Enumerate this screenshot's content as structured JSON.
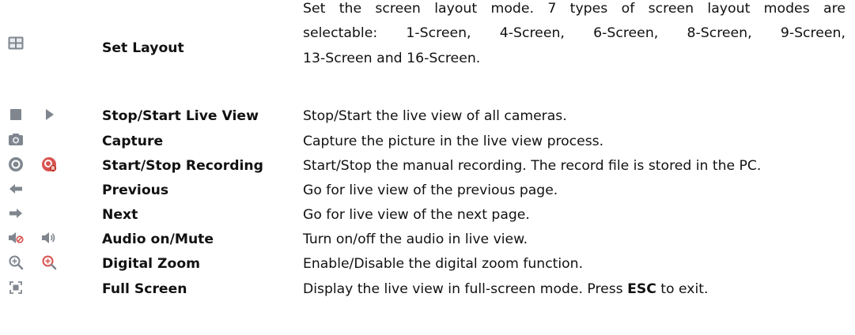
{
  "rows": [
    {
      "icons": [
        "layout-grid-icon"
      ],
      "name": "Set Layout",
      "desc_lines": [
        "Set the screen layout mode. 7 types of screen layout modes are",
        "selectable:  1-Screen,  4-Screen,  6-Screen,  8-Screen,  9-Screen,",
        "13-Screen and 16-Screen."
      ]
    },
    {
      "icons": [
        "stop-icon",
        "play-icon"
      ],
      "name": "Stop/Start Live View",
      "desc": "Stop/Start the live view of all cameras."
    },
    {
      "icons": [
        "camera-icon"
      ],
      "name": "Capture",
      "desc": "Capture the picture in the live view process."
    },
    {
      "icons": [
        "record-icon",
        "recording-active-icon"
      ],
      "name": "Start/Stop Recording",
      "desc": "Start/Stop the manual recording. The record file is stored in the PC."
    },
    {
      "icons": [
        "arrow-left-icon"
      ],
      "name": "Previous",
      "desc": "Go for live view of the previous page."
    },
    {
      "icons": [
        "arrow-right-icon"
      ],
      "name": "Next",
      "desc": "Go for live view of the next page."
    },
    {
      "icons": [
        "audio-muted-icon",
        "audio-on-icon"
      ],
      "name": "Audio on/Mute",
      "desc": "Turn on/off the audio in live view."
    },
    {
      "icons": [
        "zoom-in-icon",
        "zoom-in-active-icon"
      ],
      "name": "Digital Zoom",
      "desc": "Enable/Disable the digital zoom function."
    },
    {
      "icons": [
        "fullscreen-icon"
      ],
      "name": "Full Screen",
      "desc_pre": "Display the live view in full-screen mode. Press ",
      "desc_key": "ESC",
      "desc_post": " to exit."
    }
  ],
  "colors": {
    "icon_gray": "#8a8f96",
    "icon_red": "#d9534f",
    "icon_green": "#6aa84f"
  }
}
